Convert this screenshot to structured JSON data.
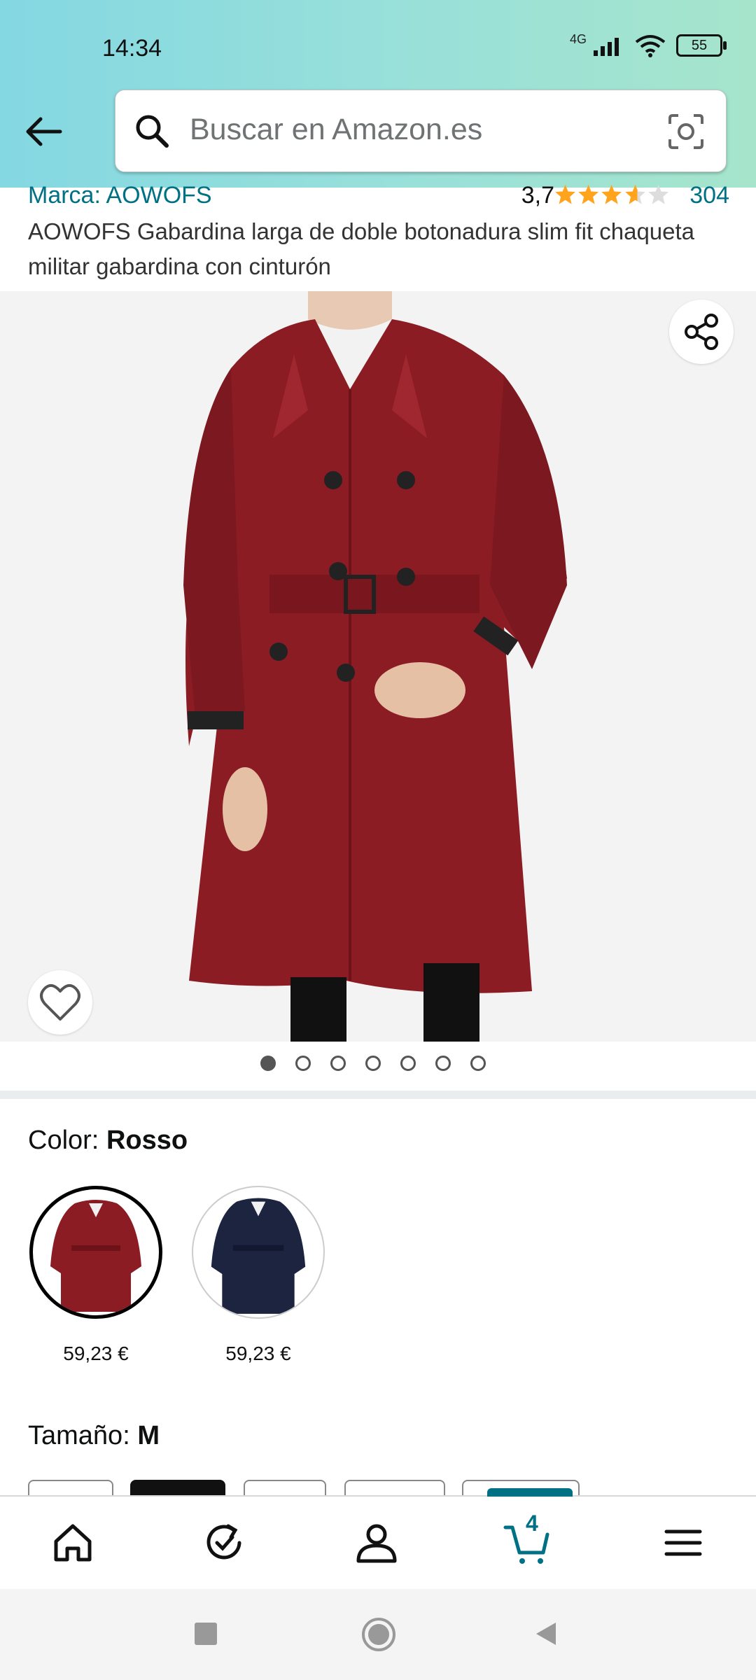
{
  "status_bar": {
    "time": "14:34",
    "network": "4G",
    "battery": "55"
  },
  "search": {
    "placeholder": "Buscar en Amazon.es"
  },
  "product": {
    "brand": "Marca: AOWOFS",
    "rating": "3,7",
    "review_count": "304",
    "title": "AOWOFS Gabardina larga de doble botonadura slim fit chaqueta militar gabardina con cinturón"
  },
  "gallery": {
    "image_count": 7,
    "active_index": 0
  },
  "color": {
    "label": "Color:",
    "value": "Rosso",
    "options": [
      {
        "price": "59,23 €",
        "color": "#8b1c24"
      },
      {
        "price": "59,23 €",
        "color": "#1c2440"
      }
    ]
  },
  "size": {
    "label": "Tamaño:",
    "value": "M"
  },
  "bottom_nav": {
    "cart_count": "4",
    "items": [
      "home-icon",
      "refresh-check-icon",
      "account-icon",
      "cart-icon",
      "menu-icon"
    ]
  },
  "colors": {
    "link": "#007185",
    "star": "#ffa41c",
    "header_start": "#84d8e2",
    "header_end": "#a6e5cc"
  }
}
